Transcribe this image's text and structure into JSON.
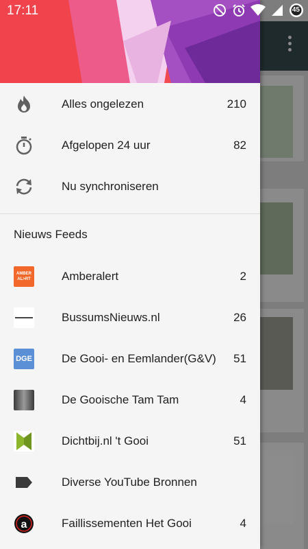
{
  "status_bar": {
    "time": "17:11",
    "icons": [
      "do-not-disturb-icon",
      "alarm-icon",
      "wifi-icon",
      "signal-icon",
      "battery-icon"
    ],
    "battery_level": "45"
  },
  "drawer": {
    "top_items": [
      {
        "icon": "flame-icon",
        "label": "Alles ongelezen",
        "count": "210"
      },
      {
        "icon": "stopwatch-icon",
        "label": "Afgelopen 24 uur",
        "count": "82"
      },
      {
        "icon": "sync-icon",
        "label": "Nu synchroniseren",
        "count": ""
      }
    ],
    "section_title": "Nieuws Feeds",
    "feeds": [
      {
        "icon": "amberalert-logo",
        "label": "Amberalert",
        "count": "2"
      },
      {
        "icon": "bussumsnieuws-logo",
        "label": "BussumsNieuws.nl",
        "count": "26"
      },
      {
        "icon": "dge-logo",
        "label": "De Gooi- en Eemlander(G&V)",
        "count": "51"
      },
      {
        "icon": "gooische-tam-tam-logo",
        "label": "De Gooische Tam Tam",
        "count": "4"
      },
      {
        "icon": "dichtbij-logo",
        "label": "Dichtbij.nl 't Gooi",
        "count": "51"
      },
      {
        "icon": "tag-icon",
        "label": "Diverse YouTube Bronnen",
        "count": ""
      },
      {
        "icon": "faillissementen-logo",
        "label": "Faillissementen Het Gooi",
        "count": "4"
      }
    ]
  },
  "colors": {
    "drawer_bg": "#f5f5f5",
    "toolbar_bg": "#1e2a2c",
    "icon_gray": "#616161",
    "hero_red": "#f2454e",
    "hero_purple": "#8e3ab3"
  }
}
